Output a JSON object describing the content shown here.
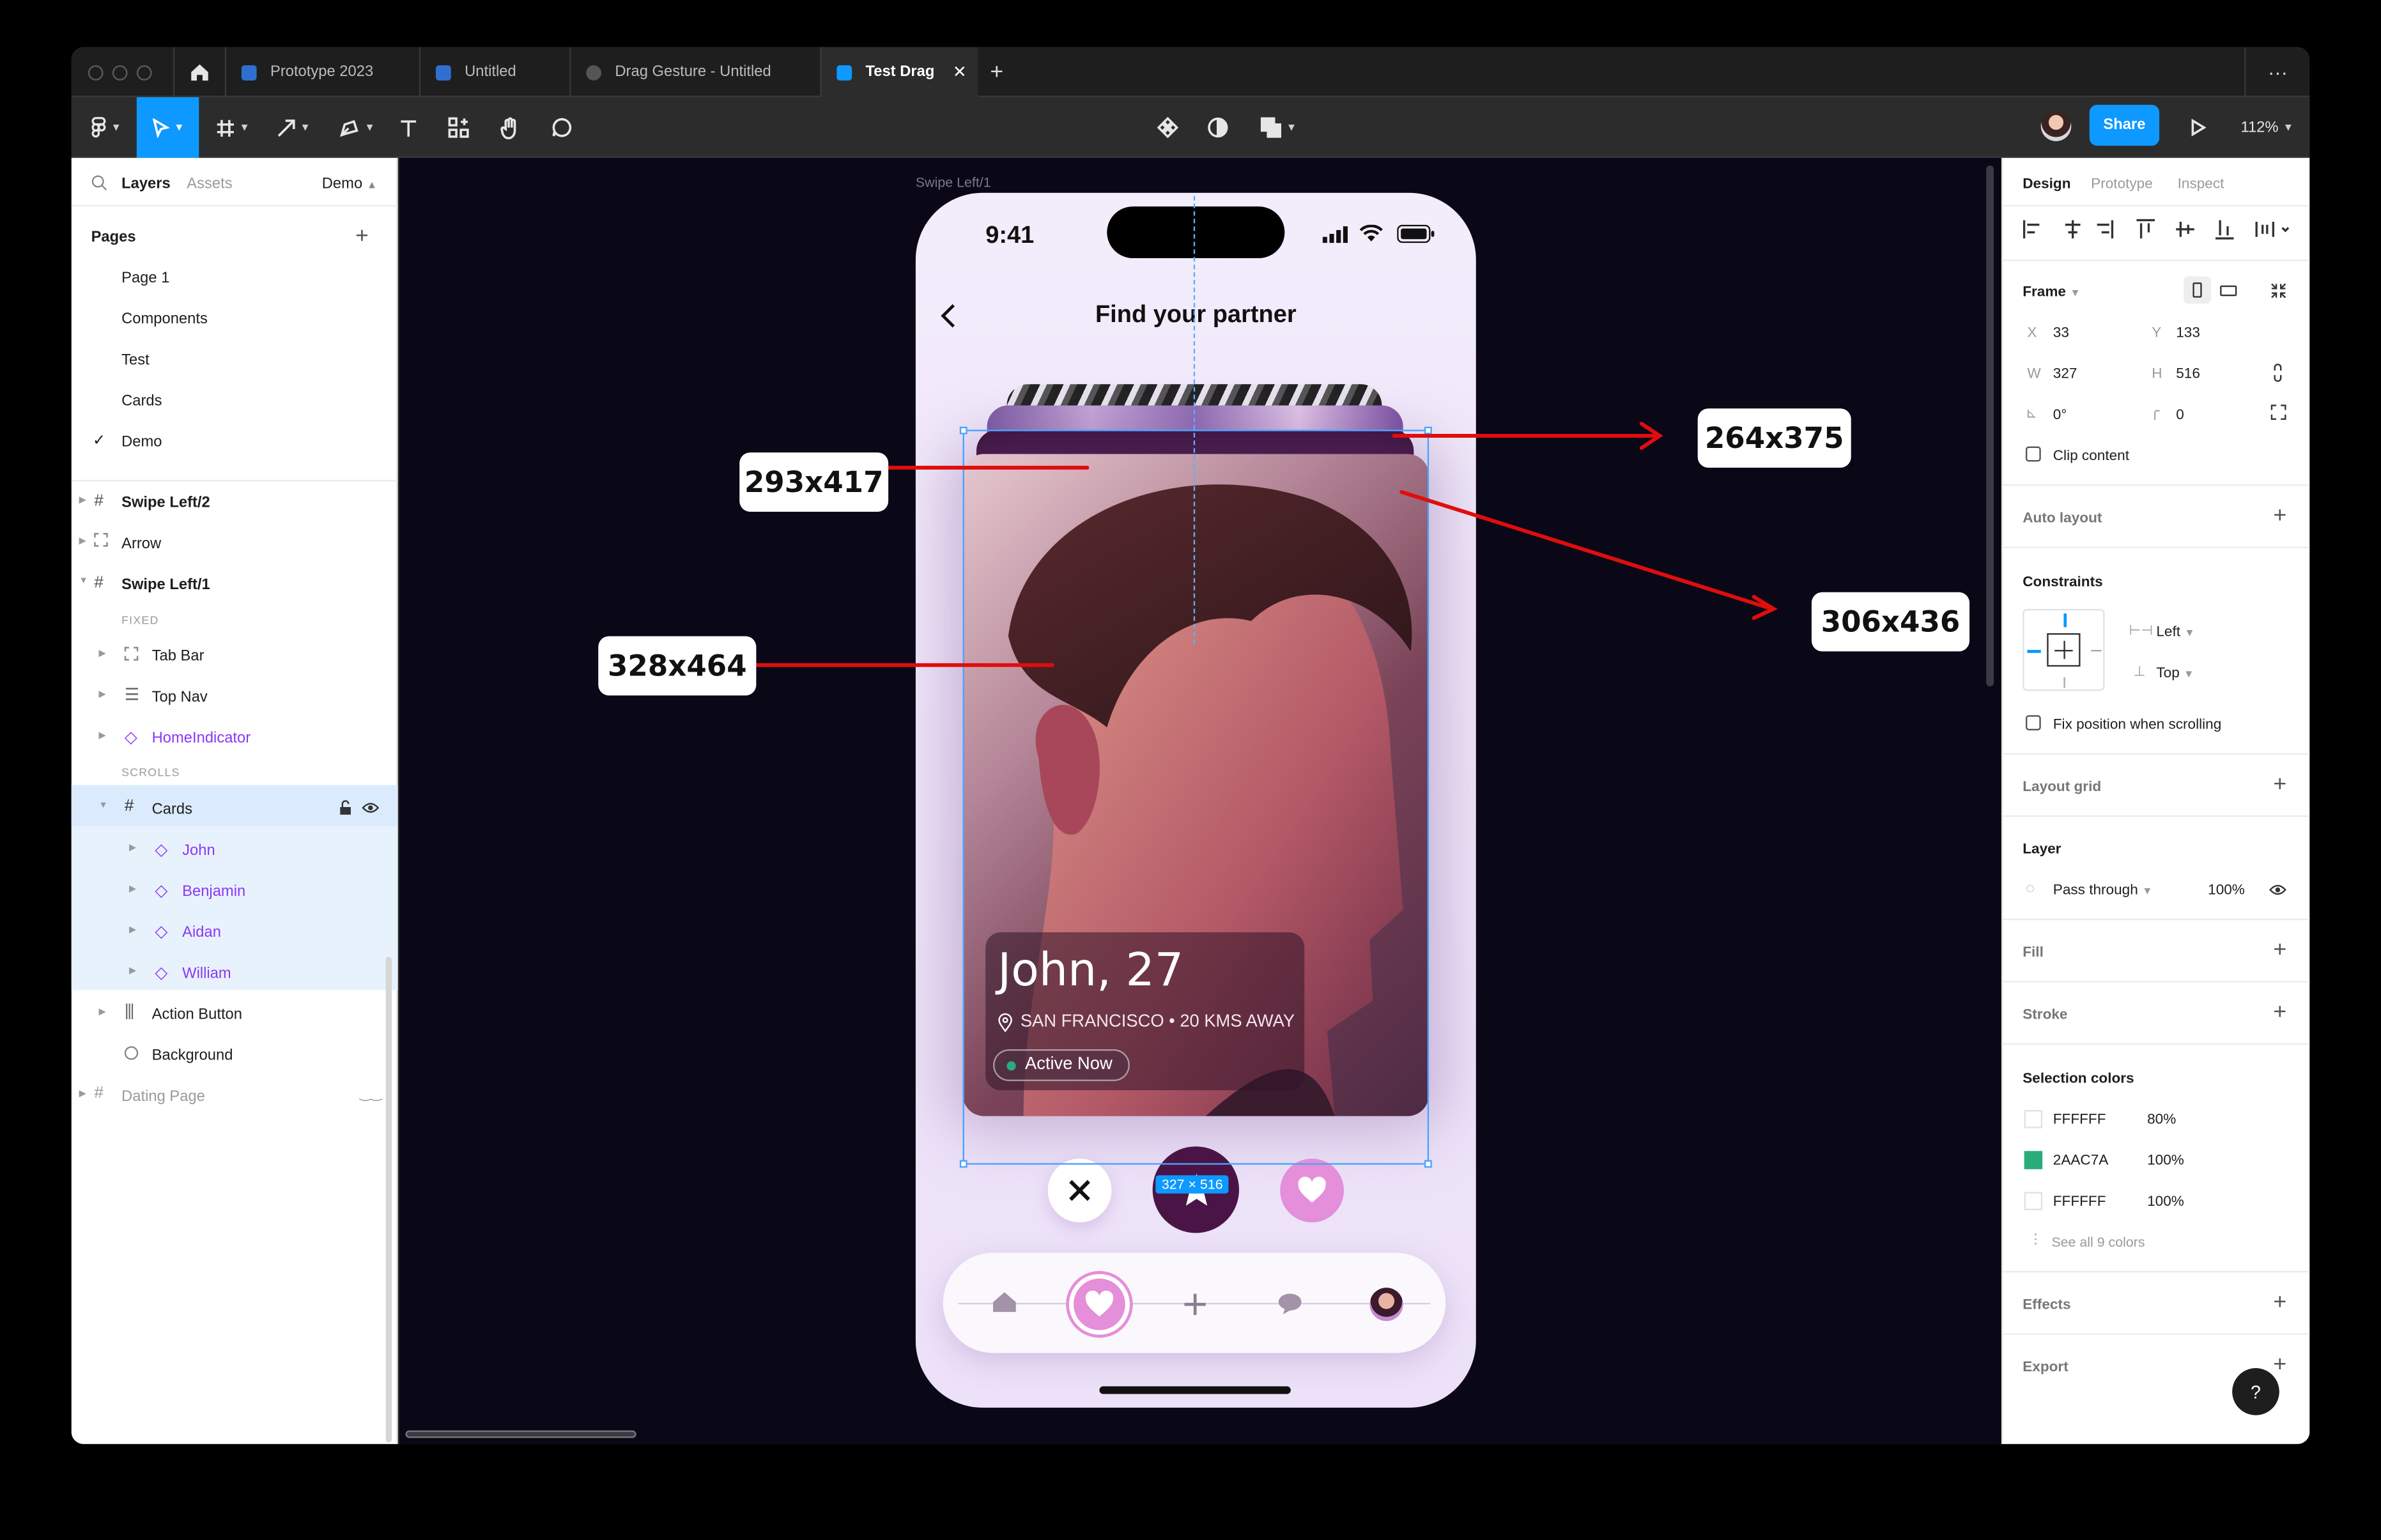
{
  "tabs": {
    "home_icon": "home-icon",
    "items": [
      {
        "label": "Prototype 2023"
      },
      {
        "label": "Untitled"
      },
      {
        "label": "Drag Gesture - Untitled"
      },
      {
        "label": "Test Drag"
      }
    ],
    "close": "✕",
    "add": "+",
    "more": "···"
  },
  "toolbar": {
    "share": "Share",
    "zoom": "112%"
  },
  "left": {
    "tab_layers": "Layers",
    "tab_assets": "Assets",
    "page_select": "Demo",
    "pages_title": "Pages",
    "pages": [
      "Page 1",
      "Components",
      "Test",
      "Cards",
      "Demo"
    ],
    "layers": {
      "swipe2": "Swipe Left/2",
      "arrow": "Arrow",
      "swipe1": "Swipe Left/1",
      "fixed": "FIXED",
      "tabbar": "Tab Bar",
      "topnav": "Top Nav",
      "homeind": "HomeIndicator",
      "scrolls": "SCROLLS",
      "cards": "Cards",
      "children": [
        "John",
        "Benjamin",
        "Aidan",
        "William"
      ],
      "action": "Action Button",
      "background": "Background",
      "dating": "Dating Page"
    }
  },
  "canvas": {
    "frame_label": "Swipe Left/1",
    "time": "9:41",
    "title": "Find your partner",
    "card_name": "John, 27",
    "card_location": "SAN FRANCISCO • 20 KMS AWAY",
    "card_status": "Active Now",
    "size_badge": "327 × 516",
    "callouts": [
      "264x375",
      "293x417",
      "306x436",
      "328x464"
    ]
  },
  "right": {
    "tabs": [
      "Design",
      "Prototype",
      "Inspect"
    ],
    "frame": "Frame",
    "x_label": "X",
    "x": "33",
    "y_label": "Y",
    "y": "133",
    "w_label": "W",
    "w": "327",
    "h_label": "H",
    "h": "516",
    "rot": "0°",
    "radius": "0",
    "clip": "Clip content",
    "auto_layout": "Auto layout",
    "constraints": "Constraints",
    "c_left": "Left",
    "c_top": "Top",
    "fix_pos": "Fix position when scrolling",
    "layout_grid": "Layout grid",
    "layer": "Layer",
    "pass": "Pass through",
    "opacity": "100%",
    "fill": "Fill",
    "stroke": "Stroke",
    "sel_colors": "Selection colors",
    "colors": [
      {
        "hex": "FFFFFF",
        "pct": "80%",
        "swatch": "#ffffff"
      },
      {
        "hex": "2AAC7A",
        "pct": "100%",
        "swatch": "#2aac7a"
      },
      {
        "hex": "FFFFFF",
        "pct": "100%",
        "swatch": "#ffffff"
      }
    ],
    "see_all": "See all 9 colors",
    "effects": "Effects",
    "export": "Export",
    "help": "?"
  },
  "colors": {
    "accent": "#0d99ff",
    "arrow_red": "#e00d0d",
    "card_dark": "#4a1546",
    "pink": "#e58ed9"
  }
}
